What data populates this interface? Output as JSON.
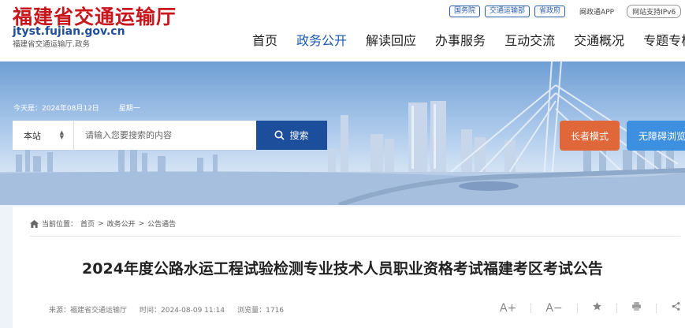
{
  "header": {
    "title": "福建省交通运输厅",
    "domain": "jtyst.fujian.gov.cn",
    "subtitle": "福建省交通运输厅.政务",
    "top_links": [
      "国务院",
      "交通运输部",
      "省政府"
    ],
    "app_label": "闽政通APP",
    "ipv6_label": "网站支持IPv6"
  },
  "nav": {
    "items": [
      "首页",
      "政务公开",
      "解读回应",
      "办事服务",
      "互动交流",
      "交通概况",
      "专题专栏"
    ],
    "active": "政务公开"
  },
  "banner": {
    "date_label": "今天是：2024年08月12日",
    "weekday": "星期一"
  },
  "search": {
    "scope": "本站",
    "placeholder": "请输入您要搜索的内容",
    "button_label": "搜索"
  },
  "modes": {
    "elder": "长者模式",
    "accessible": "无障碍浏览"
  },
  "breadcrumb": {
    "label": "当前位置：",
    "items": [
      "首页",
      "政务公开",
      "公告通告"
    ]
  },
  "article": {
    "title": "2024年度公路水运工程试验检测专业技术人员职业资格考试福建考区考试公告",
    "source": "来源：福建省交通运输厅",
    "time": "时间：2024-08-09 11:14",
    "views": "浏览量：1716"
  },
  "tools": {
    "font_up": "A+",
    "font_down": "A−",
    "favorite_icon": "star-icon",
    "print_icon": "printer-icon",
    "share_icon": "share-icon"
  },
  "colors": {
    "brand_red": "#c8161d",
    "nav_active": "#1a5aaf",
    "search_button": "#1c4e9b",
    "elder_mode": "#e0673a",
    "accessible_mode": "#3d8fe0"
  }
}
